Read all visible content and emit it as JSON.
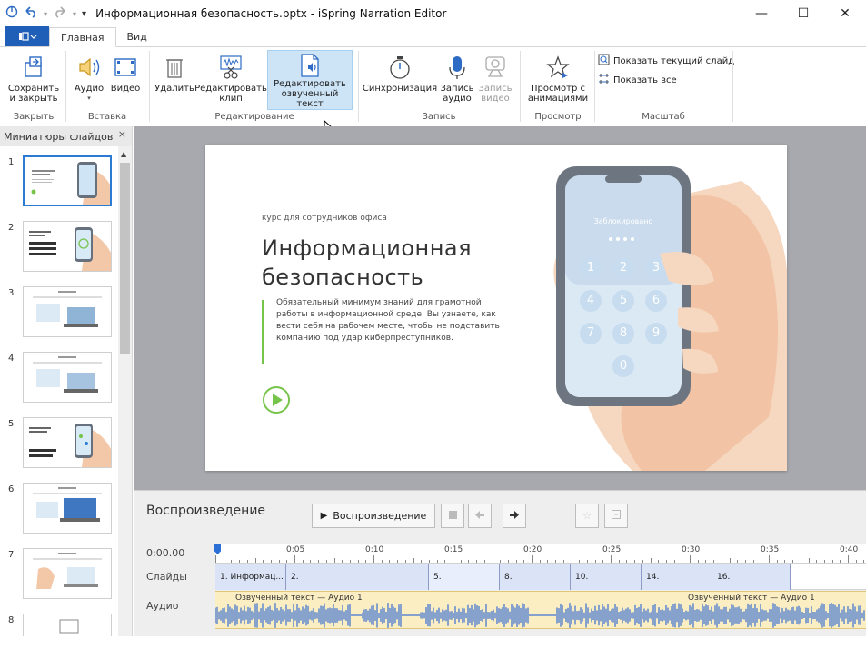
{
  "app": {
    "title": "Информационная безопасность.pptx - iSpring Narration Editor",
    "accent": "#1f5fb8"
  },
  "window_controls": {
    "minimize": "—",
    "maximize": "☐",
    "close": "✕"
  },
  "ribbon_tabs": [
    {
      "label": "Главная",
      "active": true
    },
    {
      "label": "Вид",
      "active": false
    }
  ],
  "ribbon": {
    "close_group": {
      "label": "Закрыть",
      "save_close": "Сохранить\nи закрыть"
    },
    "insert_group": {
      "label": "Вставка",
      "audio": "Аудио",
      "video": "Видео"
    },
    "edit_group": {
      "label": "Редактирование",
      "delete": "Удалить",
      "edit_clip": "Редактировать\nклип",
      "edit_narration": "Редактировать\nозвученный текст"
    },
    "record_group": {
      "label": "Запись",
      "sync": "Синхронизация",
      "record_audio": "Запись\nаудио",
      "record_video": "Запись\nвидео"
    },
    "preview_group": {
      "label": "Просмотр",
      "preview_anim": "Просмотр с\nанимациями"
    },
    "zoom_group": {
      "label": "Масштаб",
      "show_current": "Показать текущий слайд",
      "show_all": "Показать все"
    }
  },
  "thumbnails": {
    "header": "Миниатюры слайдов",
    "close": "×",
    "items": [
      {
        "num": "1",
        "selected": true
      },
      {
        "num": "2",
        "selected": false
      },
      {
        "num": "3",
        "selected": false
      },
      {
        "num": "4",
        "selected": false
      },
      {
        "num": "5",
        "selected": false
      },
      {
        "num": "6",
        "selected": false
      },
      {
        "num": "7",
        "selected": false
      },
      {
        "num": "8",
        "selected": false
      }
    ]
  },
  "slide": {
    "subtitle": "курс для сотрудников офиса",
    "title_line1": "Информационная",
    "title_line2": "безопасность",
    "body": "Обязательный минимум знаний для грамотной работы в информационной среде. Вы узнаете, как вести себя на рабочем месте, чтобы не подставить компанию под удар киберпреступников.",
    "phone_locked": "Заблокировано",
    "keys": [
      "1",
      "2",
      "3",
      "4",
      "5",
      "6",
      "7",
      "8",
      "9",
      "0"
    ]
  },
  "playback": {
    "title": "Воспроизведение",
    "play_button": "Воспроизведение",
    "time": "0:00.00",
    "slides_label": "Слайды",
    "audio_label": "Аудио",
    "ruler_labels": [
      "0:05",
      "0:10",
      "0:15",
      "0:20",
      "0:25",
      "0:30",
      "0:35",
      "0:40"
    ],
    "slide_segments": [
      "1. Информац...",
      "2.",
      "5.",
      "8.",
      "10.",
      "14.",
      "16."
    ],
    "audio_labels": [
      "Озвученный текст — Аудио 1",
      "Озвученный текст — Аудио 1"
    ]
  }
}
